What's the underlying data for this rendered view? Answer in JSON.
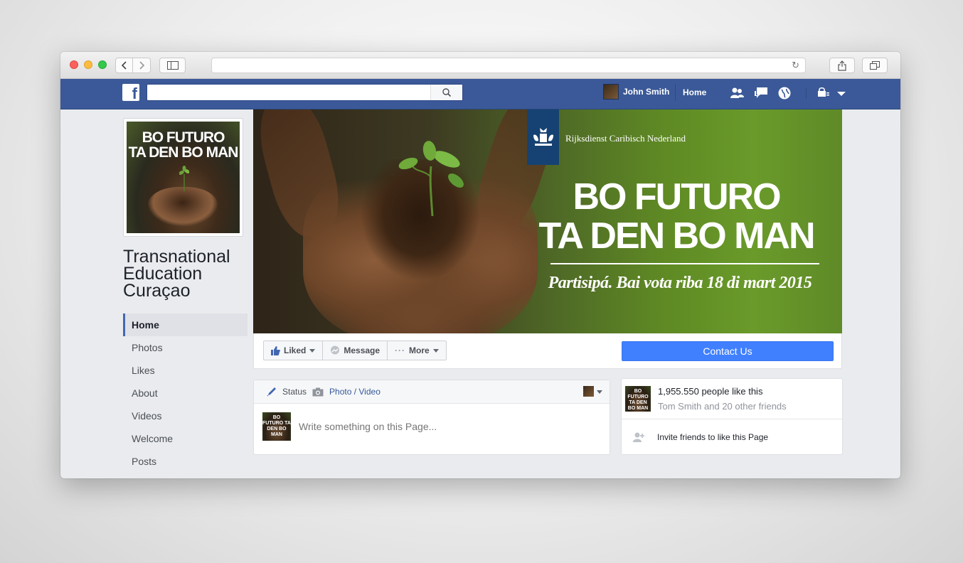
{
  "browser": {
    "address": "",
    "colors": {
      "close": "#fc605c",
      "minimize": "#fdbc40",
      "zoom": "#34c84a"
    }
  },
  "fb": {
    "logo": "f",
    "search_placeholder": "",
    "user_name": "John Smith",
    "home_label": "Home",
    "brand_color": "#3b5998"
  },
  "page": {
    "profile_line1": "BO FUTURO",
    "profile_line2": "TA DEN BO MAN",
    "name": "Transnational Education Curaçao",
    "nav": [
      {
        "label": "Home",
        "active": true
      },
      {
        "label": "Photos"
      },
      {
        "label": "Likes"
      },
      {
        "label": "About"
      },
      {
        "label": "Videos"
      },
      {
        "label": "Welcome"
      },
      {
        "label": "Posts"
      }
    ]
  },
  "cover": {
    "org": "Rijksdienst Caribisch Nederland",
    "line1": "BO FUTURO",
    "line2": "TA DEN BO MAN",
    "line3": "Partisipá. Bai vota riba 18 di mart 2015"
  },
  "actions": {
    "liked": "Liked",
    "message": "Message",
    "more": "More",
    "contact": "Contact Us",
    "contact_color": "#4080ff"
  },
  "composer": {
    "status": "Status",
    "photo": "Photo / Video",
    "placeholder": "Write something on this Page...",
    "avatar_text": "BO FUTURO TA DEN BO MAN"
  },
  "likes": {
    "count": "1,955.550 people like this",
    "friends": "Tom Smith and 20 other friends",
    "invite": "Invite friends to like this Page"
  }
}
